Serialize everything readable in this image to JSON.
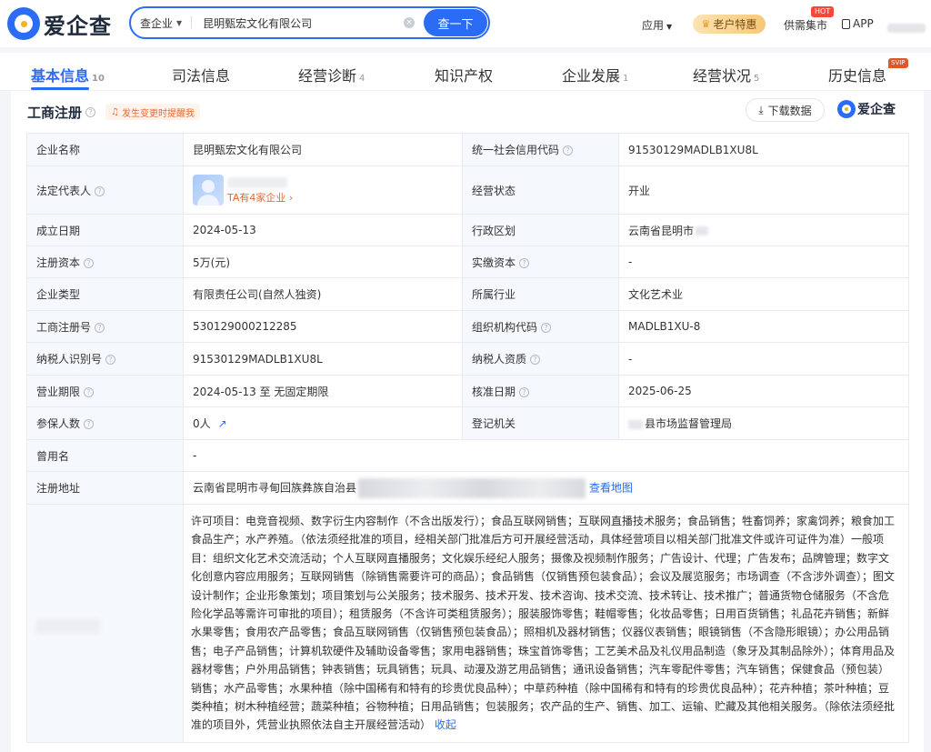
{
  "header": {
    "logo_text": "爱企查",
    "search_type": "查企业",
    "search_value": "昆明甄宏文化有限公司",
    "search_button": "查一下",
    "apps_label": "应用",
    "vip_label": "老户特惠",
    "market_label": "供需集市",
    "hot_badge": "HOT",
    "app_label": "APP"
  },
  "tabs": [
    {
      "label": "基本信息",
      "count": "10"
    },
    {
      "label": "司法信息",
      "count": ""
    },
    {
      "label": "经营诊断",
      "count": "4"
    },
    {
      "label": "知识产权",
      "count": ""
    },
    {
      "label": "企业发展",
      "count": "1"
    },
    {
      "label": "经营状况",
      "count": "5"
    },
    {
      "label": "历史信息",
      "count": ""
    }
  ],
  "svip_badge": "SVIP",
  "section": {
    "title": "工商注册",
    "remind": "发生变更时提醒我",
    "download": "下载数据",
    "brand": "爱企查"
  },
  "info": {
    "company_name_key": "企业名称",
    "company_name": "昆明甄宏文化有限公司",
    "credit_code_key": "统一社会信用代码",
    "credit_code": "91530129MADLB1XU8L",
    "legal_rep_key": "法定代表人",
    "legal_rep_link": "TA有4家企业",
    "status_key": "经营状态",
    "status": "开业",
    "found_date_key": "成立日期",
    "found_date": "2024-05-13",
    "region_key": "行政区划",
    "region": "云南省昆明市",
    "reg_capital_key": "注册资本",
    "reg_capital": "5万(元)",
    "paid_capital_key": "实缴资本",
    "paid_capital": "-",
    "type_key": "企业类型",
    "type": "有限责任公司(自然人独资)",
    "industry_key": "所属行业",
    "industry": "文化艺术业",
    "reg_no_key": "工商注册号",
    "reg_no": "530129000212285",
    "org_code_key": "组织机构代码",
    "org_code": "MADLB1XU-8",
    "tax_id_key": "纳税人识别号",
    "tax_id": "91530129MADLB1XU8L",
    "tax_qual_key": "纳税人资质",
    "tax_qual": "-",
    "term_key": "营业期限",
    "term": "2024-05-13 至 无固定期限",
    "approve_key": "核准日期",
    "approve": "2025-06-25",
    "insured_key": "参保人数",
    "insured": "0人",
    "authority_key": "登记机关",
    "authority": "县市场监督管理局",
    "former_name_key": "曾用名",
    "former_name": "-",
    "address_key": "注册地址",
    "address": "云南省昆明市寻甸回族彝族自治县",
    "map_link": "查看地图",
    "scope": "许可项目：电竞音视频、数字衍生内容制作（不含出版发行）；食品互联网销售；互联网直播技术服务；食品销售；牲畜饲养；家禽饲养；粮食加工食品生产；水产养殖。（依法须经批准的项目，经相关部门批准后方可开展经营活动，具体经营项目以相关部门批准文件或许可证件为准）一般项目：组织文化艺术交流活动；个人互联网直播服务；文化娱乐经纪人服务；摄像及视频制作服务；广告设计、代理；广告发布；品牌管理；数字文化创意内容应用服务；互联网销售（除销售需要许可的商品）；食品销售（仅销售预包装食品）；会议及展览服务；市场调查（不含涉外调查）；图文设计制作；企业形象策划；项目策划与公关服务；技术服务、技术开发、技术咨询、技术交流、技术转让、技术推广；普通货物仓储服务（不含危险化学品等需许可审批的项目）；租赁服务（不含许可类租赁服务）；服装服饰零售；鞋帽零售；化妆品零售；日用百货销售；礼品花卉销售；新鲜水果零售；食用农产品零售；食品互联网销售（仅销售预包装食品）；照相机及器材销售；仪器仪表销售；眼镜销售（不含隐形眼镜）；办公用品销售；电子产品销售；计算机软硬件及辅助设备零售；家用电器销售；珠宝首饰零售；工艺美术品及礼仪用品制造（象牙及其制品除外）；体育用品及器材零售；户外用品销售；钟表销售；玩具销售；玩具、动漫及游艺用品销售；通讯设备销售；汽车零配件零售；汽车销售；保健食品（预包装）销售；水产品零售；水果种植（除中国稀有和特有的珍贵优良品种）；中草药种植（除中国稀有和特有的珍贵优良品种）；花卉种植；茶叶种植；豆类种植；树木种植经营；蔬菜种植；谷物种植；日用品销售；包装服务；农产品的生产、销售、加工、运输、贮藏及其他相关服务。（除依法须经批准的项目外，凭营业执照依法自主开展经营活动）",
    "collapse": "收起"
  }
}
